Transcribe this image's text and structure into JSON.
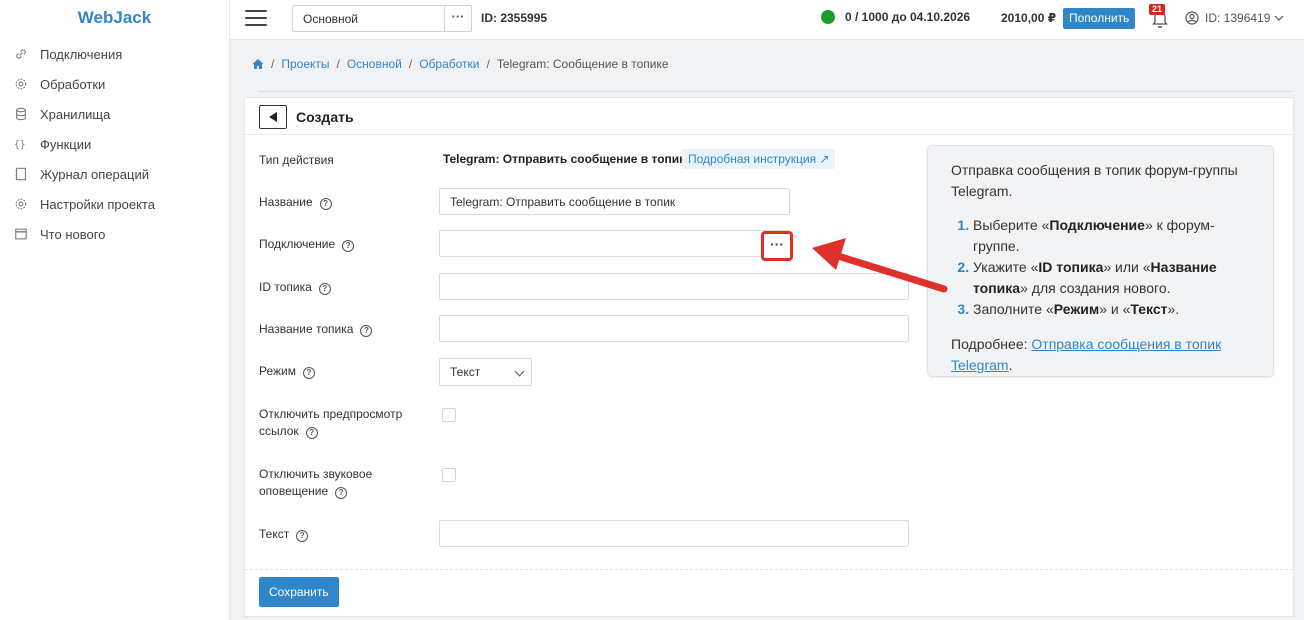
{
  "brand": "WebJack",
  "sidebar": {
    "items": [
      {
        "label": "Подключения",
        "icon": "link-icon"
      },
      {
        "label": "Обработки",
        "icon": "gear-icon"
      },
      {
        "label": "Хранилища",
        "icon": "database-icon"
      },
      {
        "label": "Функции",
        "icon": "braces-icon"
      },
      {
        "label": "Журнал операций",
        "icon": "log-icon"
      },
      {
        "label": "Настройки проекта",
        "icon": "settings-icon"
      },
      {
        "label": "Что нового",
        "icon": "calendar-icon"
      }
    ]
  },
  "topbar": {
    "project": "Основной",
    "project_more": "···",
    "project_id": "ID: 2355995",
    "quota": "0 / 1000 до 04.10.2026",
    "balance": "2010,00 ₽",
    "topup_label": "Пополнить",
    "notifications": "21",
    "user_id": "ID: 1396419"
  },
  "breadcrumb": {
    "items": [
      "Проекты",
      "Основной",
      "Обработки"
    ],
    "current": "Telegram: Сообщение в топике"
  },
  "form": {
    "title": "Создать",
    "action_type_label": "Тип действия",
    "action_type_value": "Telegram: Отправить сообщение в топик",
    "doc_link": "Подробная инструкция ↗",
    "name_label": "Название",
    "name_value": "Telegram: Отправить сообщение в топик",
    "connection_label": "Подключение",
    "connection_value": "",
    "connection_more": "···",
    "topic_id_label": "ID топика",
    "topic_name_label": "Название топика",
    "mode_label": "Режим",
    "mode_value": "Текст",
    "disable_preview_label_1": "Отключить предпросмотр",
    "disable_preview_label_2": "ссылок",
    "disable_sound_label_1": "Отключить звуковое",
    "disable_sound_label_2": "оповещение",
    "text_label": "Текст",
    "save_label": "Сохранить",
    "help_glyph": "?"
  },
  "info": {
    "intro": "Отправка сообщения в топик форум-группы Telegram.",
    "step1": {
      "a": "Выберите «",
      "b": "Подключение",
      "c": "» к форум-группе."
    },
    "step2": {
      "a": "Укажите «",
      "b": "ID топика",
      "c": "» или «",
      "d": "Название топика",
      "e": "» для создания нового."
    },
    "step3": {
      "a": "Заполните «",
      "b": "Режим",
      "c": "» и «",
      "d": "Текст",
      "e": "»."
    },
    "more_prefix": "Подробнее: ",
    "more_link": "Отправка сообщения в топик Telegram",
    "more_suffix": "."
  },
  "colors": {
    "accent": "#2f86c9",
    "status_ok": "#1c9e26",
    "highlight": "#e0302a"
  }
}
